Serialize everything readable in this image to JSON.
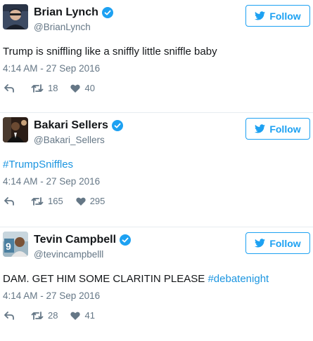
{
  "colors": {
    "accent": "#1da1f2",
    "hashtag": "#1b95e0",
    "muted": "#657786",
    "text": "#14171a",
    "divider": "#e6ecf0"
  },
  "tweets": [
    {
      "name": "Brian Lynch",
      "handle": "@BrianLynch",
      "follow_label": "Follow",
      "text": "Trump is sniffling like a sniffly little sniffle baby",
      "hashtag": "",
      "timestamp": "4:14 AM - 27 Sep 2016",
      "retweets": "18",
      "likes": "40"
    },
    {
      "name": "Bakari Sellers",
      "handle": "@Bakari_Sellers",
      "follow_label": "Follow",
      "text": "",
      "hashtag": "#TrumpSniffles",
      "timestamp": "4:14 AM - 27 Sep 2016",
      "retweets": "165",
      "likes": "295"
    },
    {
      "name": "Tevin Campbell",
      "handle": "@tevincampbelll",
      "follow_label": "Follow",
      "text": "DAM. GET HIM SOME CLARITIN PLEASE ",
      "hashtag": "#debatenight",
      "timestamp": "4:14 AM - 27 Sep 2016",
      "retweets": "28",
      "likes": "41"
    }
  ]
}
